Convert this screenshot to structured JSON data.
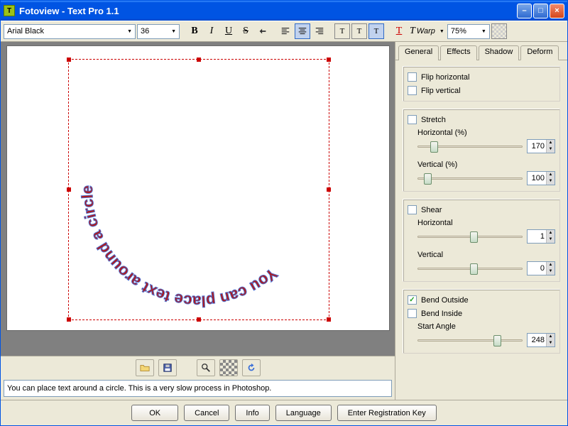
{
  "window": {
    "title": "Fotoview - Text Pro 1.1"
  },
  "toolbar": {
    "font": "Arial Black",
    "size": "36",
    "warp_label": "Warp",
    "zoom": "75%"
  },
  "tabs": {
    "general": "General",
    "effects": "Effects",
    "shadow": "Shadow",
    "deform": "Deform"
  },
  "deform": {
    "flip_h": "Flip horizontal",
    "flip_v": "Flip vertical",
    "stretch": "Stretch",
    "stretch_h_label": "Horizontal (%)",
    "stretch_h_value": "170",
    "stretch_v_label": "Vertical (%)",
    "stretch_v_value": "100",
    "shear": "Shear",
    "shear_h_label": "Horizontal",
    "shear_h_value": "1",
    "shear_v_label": "Vertical",
    "shear_v_value": "0",
    "bend_out": "Bend Outside",
    "bend_in": "Bend Inside",
    "start_angle_label": "Start Angle",
    "start_angle_value": "248"
  },
  "canvas": {
    "text": "You can place text around a circle.  This is a very slow process in Photoshop."
  },
  "input_text": "You can place text around a circle. This is a very slow process in Photoshop.",
  "buttons": {
    "ok": "OK",
    "cancel": "Cancel",
    "info": "Info",
    "language": "Language",
    "register": "Enter Registration Key"
  },
  "state": {
    "flip_h": false,
    "flip_v": false,
    "stretch_enabled": false,
    "shear_enabled": false,
    "bend_out": true,
    "bend_in": false
  },
  "slider_pos": {
    "stretch_h": 12,
    "stretch_v": 6,
    "shear_h": 50,
    "shear_v": 50,
    "start_angle": 72
  }
}
